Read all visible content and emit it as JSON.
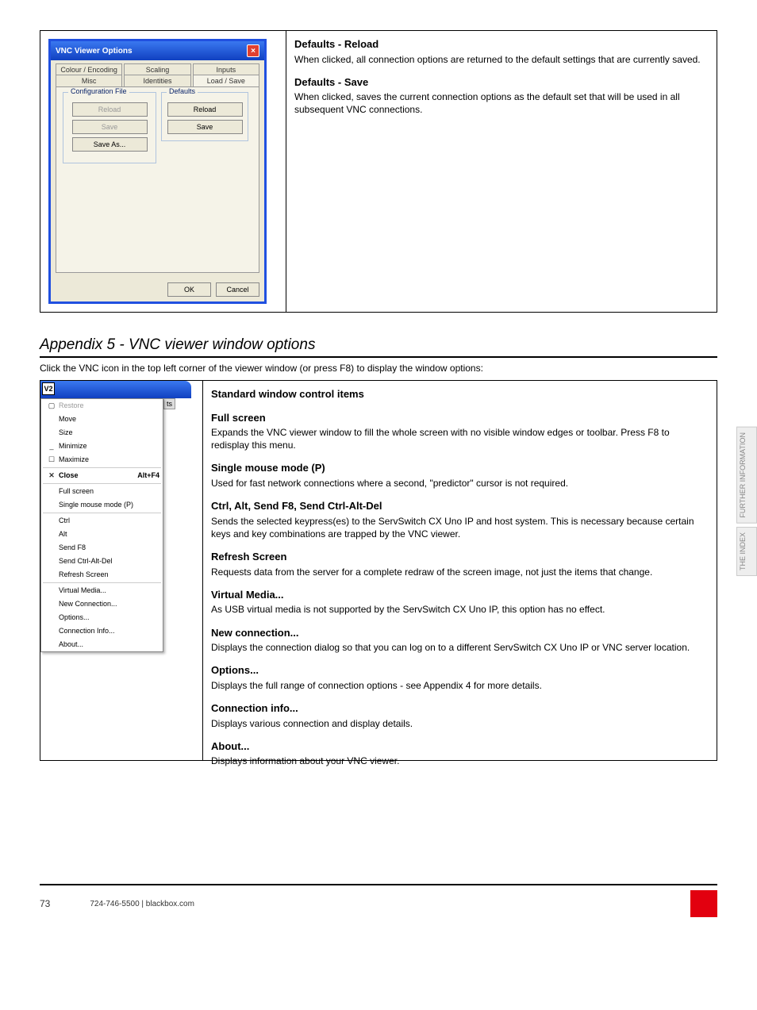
{
  "dialog": {
    "title": "VNC Viewer Options",
    "tabs_row1": [
      "Colour / Encoding",
      "Scaling",
      "Inputs"
    ],
    "tabs_row2": [
      "Misc",
      "Identities",
      "Load / Save"
    ],
    "group_config": {
      "label": "Configuration File",
      "reload": "Reload",
      "save": "Save",
      "saveas": "Save As..."
    },
    "group_defaults": {
      "label": "Defaults",
      "reload": "Reload",
      "save": "Save"
    },
    "ok": "OK",
    "cancel": "Cancel"
  },
  "top_right": {
    "h1": "Defaults - Reload",
    "p1": "When clicked, all connection options are returned to the default settings that are currently saved.",
    "h2": "Defaults - Save",
    "p2": "When clicked, saves the current connection options as the default set that will be used in all subsequent VNC connections."
  },
  "section_heading": "Appendix 5 - VNC viewer window options",
  "section_intro": "Click the VNC icon in the top left corner of the viewer window (or press F8) to display the window options:",
  "vncicon": "V2",
  "toolbarbit_text": "ts",
  "sysmenu": {
    "restore": "Restore",
    "move": "Move",
    "size": "Size",
    "minimize": "Minimize",
    "maximize": "Maximize",
    "close": "Close",
    "close_shortcut": "Alt+F4",
    "fullscreen": "Full screen",
    "single_mouse": "Single mouse mode (P)",
    "ctrl": "Ctrl",
    "alt": "Alt",
    "sendf8": "Send F8",
    "sendcad": "Send Ctrl-Alt-Del",
    "refresh": "Refresh Screen",
    "virtual_media": "Virtual Media...",
    "newconn": "New Connection...",
    "options": "Options...",
    "conninfo": "Connection Info...",
    "about": "About..."
  },
  "right_col": {
    "std_h": "Standard window control items",
    "fs_h": "Full screen",
    "fs_p": "Expands the VNC viewer window to fill the whole screen with no visible window edges or toolbar. Press F8 to redisplay this menu.",
    "sm_h": "Single mouse mode (P)",
    "sm_p": "Used for fast network connections where a second, \"predictor\" cursor is not required.",
    "ctrl_h": "Ctrl, Alt, Send F8, Send Ctrl-Alt-Del",
    "ctrl_p": "Sends the selected keypress(es) to the ServSwitch CX Uno IP and host system. This is necessary because certain keys and key combinations are trapped by the VNC viewer.",
    "ref_h": "Refresh Screen",
    "ref_p": "Requests data from the server for a complete redraw of the screen image, not just the items that change.",
    "vm_h": "Virtual Media...",
    "vm_p": "As USB virtual media is not supported by the ServSwitch CX Uno IP, this option has no effect.",
    "nc_h": "New connection...",
    "nc_p": "Displays the connection dialog so that you can log on to a different ServSwitch CX Uno IP or VNC server location.",
    "opt_h": "Options...",
    "opt_p": "Displays the full range of connection options - see Appendix 4 for more details.",
    "ci_h": "Connection info...",
    "ci_p": "Displays various connection and display details.",
    "ab_h": "About...",
    "ab_p": "Displays information about your VNC viewer."
  },
  "footer": {
    "page": "73",
    "company": "724-746-5500 | blackbox.com",
    "sidebar": [
      "FURTHER INFORMATION",
      "THE INDEX"
    ]
  }
}
